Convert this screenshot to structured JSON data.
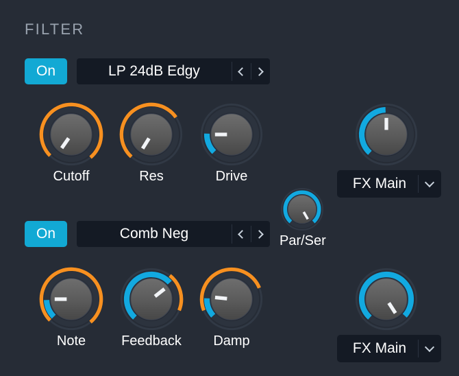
{
  "panel": {
    "title": "FILTER",
    "background": "#262c36"
  },
  "colors": {
    "accent_blue": "#12a9d4",
    "arc_blue": "#12a9e0",
    "arc_orange": "#f79020",
    "knob_face": "#5a5a5a",
    "knob_ring": "#2e3540",
    "field_bg": "#141a24",
    "text": "#ffffff",
    "title_text": "#9aa3af"
  },
  "filter1": {
    "power": {
      "label": "On",
      "state": "on"
    },
    "preset": {
      "value": "LP 24dB Edgy",
      "prev_icon": "chevron-left-icon",
      "next_icon": "chevron-right-icon"
    },
    "knobs": [
      {
        "name": "Cutoff",
        "label": "Cutoff",
        "pointer_deg": 215,
        "mod_arc": {
          "color": "#f79020",
          "start": 225,
          "end": 140
        },
        "value_arc": null
      },
      {
        "name": "Res",
        "label": "Res",
        "pointer_deg": 212,
        "mod_arc": {
          "color": "#f79020",
          "start": 222,
          "end": 55
        },
        "value_arc": null
      },
      {
        "name": "Drive",
        "label": "Drive",
        "pointer_deg": 270,
        "mod_arc": null,
        "value_arc": {
          "color": "#12a9e0",
          "start": 225,
          "end": 272
        }
      }
    ],
    "fx": {
      "knob": {
        "name": "FX Main Amount",
        "pointer_deg": 0,
        "value_arc": {
          "color": "#12a9e0",
          "start": 222,
          "end": 358
        }
      },
      "dropdown": {
        "value": "FX Main",
        "icon": "chevron-down-icon"
      }
    }
  },
  "routing": {
    "knob": {
      "name": "Par/Ser",
      "label": "Par/Ser",
      "pointer_deg": 150,
      "value_arc": {
        "color": "#12a9e0",
        "start": 222,
        "end": 138
      }
    }
  },
  "filter2": {
    "power": {
      "label": "On",
      "state": "on"
    },
    "preset": {
      "value": "Comb Neg",
      "prev_icon": "chevron-left-icon",
      "next_icon": "chevron-right-icon"
    },
    "knobs": [
      {
        "name": "Note",
        "label": "Note",
        "pointer_deg": 270,
        "mod_arc": {
          "color": "#f79020",
          "start": 225,
          "end": 140
        },
        "value_arc": {
          "color": "#12a9e0",
          "start": 225,
          "end": 268
        }
      },
      {
        "name": "Feedback",
        "label": "Feedback",
        "pointer_deg": 52,
        "mod_arc": {
          "color": "#f79020",
          "start": 38,
          "end": 112
        },
        "value_arc": {
          "color": "#12a9e0",
          "start": 222,
          "end": 48
        }
      },
      {
        "name": "Damp",
        "label": "Damp",
        "pointer_deg": 276,
        "mod_arc": {
          "color": "#f79020",
          "start": 248,
          "end": 68
        },
        "value_arc": {
          "color": "#12a9e0",
          "start": 228,
          "end": 272
        }
      }
    ],
    "fx": {
      "knob": {
        "name": "FX Main Amount",
        "pointer_deg": 147,
        "value_arc": {
          "color": "#12a9e0",
          "start": 222,
          "end": 132
        }
      },
      "dropdown": {
        "value": "FX Main",
        "icon": "chevron-down-icon"
      }
    }
  }
}
